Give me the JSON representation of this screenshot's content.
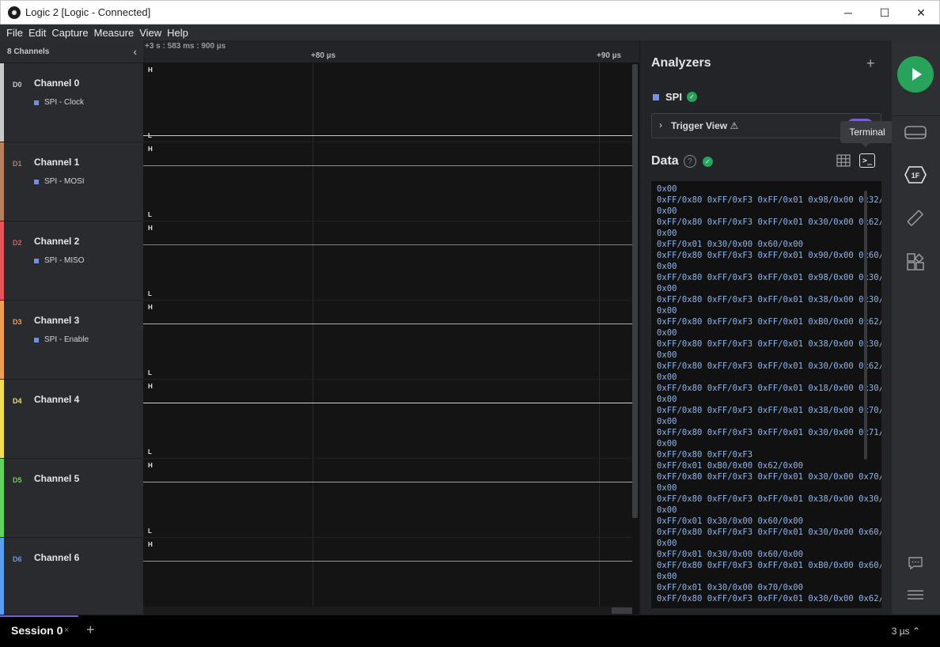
{
  "window": {
    "title": "Logic 2 [Logic - Connected]",
    "minimize": "─",
    "maximize": "☐",
    "close": "✕"
  },
  "menu": [
    "File",
    "Edit",
    "Capture",
    "Measure",
    "View",
    "Help"
  ],
  "channels_panel": {
    "header": "8 Channels",
    "collapse_icon": "‹"
  },
  "channels": [
    {
      "d": "D0",
      "name": "Channel 0",
      "sub": "SPI - Clock",
      "color": "#c8c8c8"
    },
    {
      "d": "D1",
      "name": "Channel 1",
      "sub": "SPI - MOSI",
      "color": "#b5805a"
    },
    {
      "d": "D2",
      "name": "Channel 2",
      "sub": "SPI - MISO",
      "color": "#e8525a"
    },
    {
      "d": "D3",
      "name": "Channel 3",
      "sub": "SPI - Enable",
      "color": "#f0a050"
    },
    {
      "d": "D4",
      "name": "Channel 4",
      "sub": "",
      "color": "#f0e050"
    },
    {
      "d": "D5",
      "name": "Channel 5",
      "sub": "",
      "color": "#5ed65a"
    },
    {
      "d": "D6",
      "name": "Channel 6",
      "sub": "",
      "color": "#5a9ef0"
    }
  ],
  "timeline": {
    "origin": "+3 s : 583 ms : 900 µs",
    "ticks": [
      "+80 µs",
      "+90 µs"
    ]
  },
  "levels": {
    "high": "H",
    "low": "L"
  },
  "analyzers": {
    "title": "Analyzers",
    "add": "+",
    "spi": "SPI",
    "trigger_view": "Trigger View ⚠",
    "tooltip": "Terminal",
    "data_title": "Data",
    "help": "?",
    "terminal_lines": [
      "0x00",
      "0xFF/0x80 0xFF/0xF3 0xFF/0x01 0x98/0x00 0x32/",
      "0x00",
      "0xFF/0x80 0xFF/0xF3 0xFF/0x01 0x30/0x00 0x62/",
      "0x00",
      "0xFF/0x01 0x30/0x00 0x60/0x00",
      "0xFF/0x80 0xFF/0xF3 0xFF/0x01 0x90/0x00 0x60/",
      "0x00",
      "0xFF/0x80 0xFF/0xF3 0xFF/0x01 0x98/0x00 0x30/",
      "0x00",
      "0xFF/0x80 0xFF/0xF3 0xFF/0x01 0x38/0x00 0x30/",
      "0x00",
      "0xFF/0x80 0xFF/0xF3 0xFF/0x01 0xB0/0x00 0x62/",
      "0x00",
      "0xFF/0x80 0xFF/0xF3 0xFF/0x01 0x38/0x00 0x30/",
      "0x00",
      "0xFF/0x80 0xFF/0xF3 0xFF/0x01 0x30/0x00 0x62/",
      "0x00",
      "0xFF/0x80 0xFF/0xF3 0xFF/0x01 0x18/0x00 0x30/",
      "0x00",
      "0xFF/0x80 0xFF/0xF3 0xFF/0x01 0x38/0x00 0x70/",
      "0x00",
      "0xFF/0x80 0xFF/0xF3 0xFF/0x01 0x30/0x00 0x71/",
      "0x00",
      "0xFF/0x80 0xFF/0xF3",
      "0xFF/0x01 0xB0/0x00 0x62/0x00",
      "0xFF/0x80 0xFF/0xF3 0xFF/0x01 0x30/0x00 0x70/",
      "0x00",
      "0xFF/0x80 0xFF/0xF3 0xFF/0x01 0x38/0x00 0x30/",
      "0x00",
      "0xFF/0x01 0x30/0x00 0x60/0x00",
      "0xFF/0x80 0xFF/0xF3 0xFF/0x01 0x30/0x00 0x60/",
      "0x00",
      "0xFF/0x01 0x30/0x00 0x60/0x00",
      "0xFF/0x80 0xFF/0xF3 0xFF/0x01 0xB0/0x00 0x60/",
      "0x00",
      "0xFF/0x01 0x30/0x00 0x70/0x00",
      "0xFF/0x80 0xFF/0xF3 0xFF/0x01 0x30/0x00 0x62/"
    ]
  },
  "sidebar": {
    "badge": "1F"
  },
  "bottom": {
    "session": "Session 0",
    "close": "×",
    "add": "+",
    "zoom": "3 µs ⌃"
  },
  "colors": {
    "accent_green": "#27a35a",
    "accent_purple": "#7b5ed6",
    "analyzer_blue": "#6f8fe8"
  }
}
